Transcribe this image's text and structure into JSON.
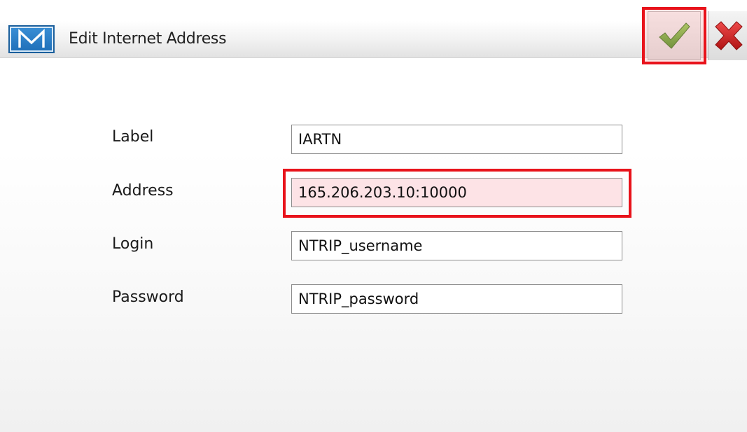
{
  "window": {
    "title": "Edit Internet Address",
    "logo_letter": "M",
    "logo_icon": "m-logo-icon",
    "ok_icon": "checkmark-icon",
    "cancel_icon": "x-icon"
  },
  "form": {
    "fields": [
      {
        "label": "Label",
        "value": "IARTN"
      },
      {
        "label": "Address",
        "value": "165.206.203.10:10000"
      },
      {
        "label": "Login",
        "value": "NTRIP_username"
      },
      {
        "label": "Password",
        "value": "NTRIP_password"
      }
    ]
  },
  "colors": {
    "highlight_border": "#e8131b",
    "highlight_fill": "#fde3e6",
    "logo_blue": "#1f6fb8",
    "check_green": "#4d9a1e",
    "x_red": "#d42020"
  }
}
